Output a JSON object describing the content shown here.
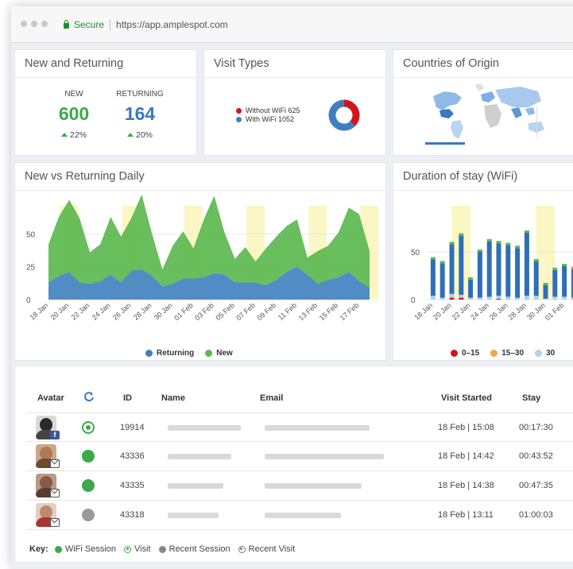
{
  "browser": {
    "secure_label": "Secure",
    "url": "https://app.amplespot.com"
  },
  "cards": {
    "new_returning": {
      "title": "New and Returning",
      "new_label": "NEW",
      "new_value": "600",
      "new_change": "22%",
      "returning_label": "RETURNING",
      "returning_value": "164",
      "returning_change": "20%"
    },
    "visit_types": {
      "title": "Visit Types",
      "without_wifi_label": "Without WiFi 625",
      "with_wifi_label": "With WiFi 1052"
    },
    "countries": {
      "title": "Countries of Origin"
    },
    "daily": {
      "title": "New vs Returning Daily"
    },
    "duration": {
      "title": "Duration of stay (WiFi)"
    }
  },
  "colors": {
    "green": "#5cb84f",
    "blue": "#3f7fc1",
    "red": "#d0161d",
    "orange": "#f0a848",
    "light_blue": "#a8d4ec",
    "highlight": "#fbf7c4",
    "new_value": "#3aaa4a",
    "returning_value": "#3a78c2"
  },
  "chart_data": [
    {
      "type": "pie",
      "categories": [
        "Without WiFi",
        "With WiFi"
      ],
      "values": [
        625,
        1052
      ]
    },
    {
      "type": "area",
      "x": [
        "18 Jan",
        "19 Jan",
        "20 Jan",
        "21 Jan",
        "22 Jan",
        "23 Jan",
        "24 Jan",
        "25 Jan",
        "26 Jan",
        "27 Jan",
        "28 Jan",
        "29 Jan",
        "30 Jan",
        "31 Jan",
        "01 Feb",
        "02 Feb",
        "03 Feb",
        "04 Feb",
        "05 Feb",
        "06 Feb",
        "07 Feb",
        "08 Feb",
        "09 Feb",
        "10 Feb",
        "11 Feb",
        "12 Feb",
        "13 Feb",
        "14 Feb",
        "15 Feb",
        "16 Feb",
        "17 Feb",
        "18 Feb"
      ],
      "tick_labels": [
        "18 Jan",
        "20 Jan",
        "22 Jan",
        "24 Jan",
        "26 Jan",
        "28 Jan",
        "30 Jan",
        "01 Feb",
        "03 Feb",
        "05 Feb",
        "07 Feb",
        "09 Feb",
        "11 Feb",
        "13 Feb",
        "15 Feb",
        "17 Feb"
      ],
      "series": [
        {
          "name": "Returning",
          "values": [
            13,
            18,
            21,
            13,
            12,
            14,
            19,
            13,
            22,
            23,
            18,
            10,
            12,
            16,
            16,
            17,
            20,
            19,
            13,
            13,
            13,
            11,
            15,
            21,
            25,
            19,
            12,
            15,
            17,
            21,
            14,
            9
          ]
        },
        {
          "name": "New",
          "values": [
            29,
            45,
            55,
            49,
            24,
            28,
            44,
            35,
            40,
            57,
            32,
            13,
            29,
            36,
            23,
            44,
            59,
            32,
            18,
            27,
            16,
            28,
            33,
            35,
            36,
            13,
            25,
            26,
            34,
            49,
            51,
            28
          ]
        }
      ],
      "y_ticks": [
        0,
        25,
        50
      ],
      "ylim": [
        0,
        75
      ],
      "legend": "bottom"
    },
    {
      "type": "bar",
      "stacked": true,
      "x": [
        "18 Jan",
        "19 Jan",
        "20 Jan",
        "21 Jan",
        "22 Jan",
        "23 Jan",
        "24 Jan",
        "25 Jan",
        "26 Jan",
        "27 Jan",
        "28 Jan",
        "29 Jan",
        "30 Jan",
        "31 Jan",
        "01 Feb",
        "02 Feb"
      ],
      "tick_labels": [
        "18 Jan",
        "20 Jan",
        "22 Jan",
        "24 Jan",
        "26 Jan",
        "28 Jan",
        "30 Jan",
        "01 Feb"
      ],
      "series": [
        {
          "name": "0–15",
          "values": [
            0,
            0,
            2,
            2,
            0,
            0,
            0,
            1,
            0,
            0,
            0,
            0,
            0,
            0,
            0,
            0
          ]
        },
        {
          "name": "15–30",
          "values": [
            0,
            0,
            0,
            0,
            0,
            0,
            0,
            0,
            0,
            0,
            0,
            0,
            0,
            0,
            0,
            0
          ]
        },
        {
          "name": "30",
          "values": [
            4,
            2,
            4,
            3,
            2,
            2,
            3,
            3,
            3,
            2,
            4,
            4,
            1,
            3,
            3,
            2
          ]
        },
        {
          "name": "",
          "values": [
            38,
            36,
            52,
            62,
            19,
            48,
            58,
            55,
            54,
            52,
            66,
            36,
            14,
            28,
            32,
            30
          ]
        }
      ],
      "y_ticks": [
        0,
        50
      ],
      "ylim": [
        0,
        100
      ],
      "legend": "bottom"
    }
  ],
  "table": {
    "headers": {
      "avatar": "Avatar",
      "id": "ID",
      "name": "Name",
      "email": "Email",
      "visit_started": "Visit Started",
      "stay": "Stay"
    },
    "rows": [
      {
        "id": "19914",
        "visit_started": "18 Feb | 15:08",
        "stay": "00:17:30"
      },
      {
        "id": "43336",
        "visit_started": "18 Feb | 14:42",
        "stay": "00:43:52"
      },
      {
        "id": "43335",
        "visit_started": "18 Feb | 14:38",
        "stay": "00:47:35"
      },
      {
        "id": "43318",
        "visit_started": "18 Feb | 13:11",
        "stay": "01:00:03"
      }
    ]
  },
  "key": {
    "label": "Key:",
    "wifi_session": "WiFi Session",
    "visit": "Visit",
    "recent_session": "Recent Session",
    "recent_visit": "Recent Visit"
  }
}
